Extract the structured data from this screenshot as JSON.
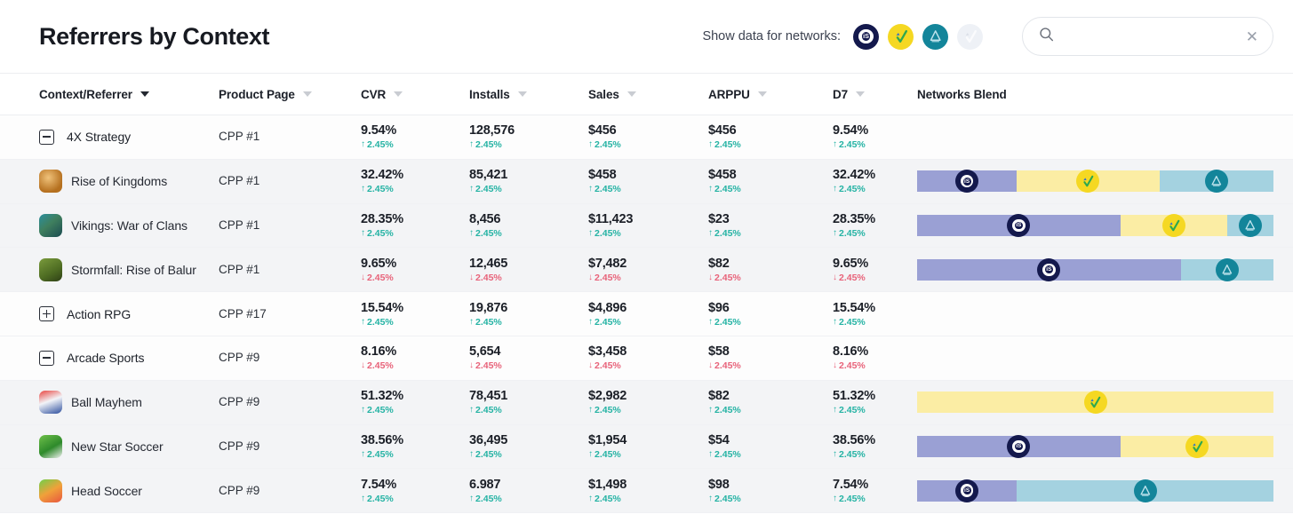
{
  "header": {
    "title": "Referrers by Context",
    "networks_label": "Show data for networks:",
    "networks": [
      {
        "name": "ironSource",
        "icon": "ironsource-icon",
        "active": true
      },
      {
        "name": "Vungle",
        "icon": "vungle-icon",
        "active": true
      },
      {
        "name": "AppLovin",
        "icon": "applovin-icon",
        "active": true
      },
      {
        "name": "Unity Ads",
        "icon": "unity-ads-icon",
        "active": false
      }
    ],
    "search": {
      "value": "",
      "placeholder": "",
      "icon": "search-icon",
      "clear_icon": "close-icon"
    }
  },
  "table": {
    "columns": [
      {
        "key": "context",
        "label": "Context/Referrer",
        "sortable": true,
        "sort_active": true
      },
      {
        "key": "product",
        "label": "Product Page",
        "sortable": true,
        "sort_active": false
      },
      {
        "key": "cvr",
        "label": "CVR",
        "sortable": true,
        "sort_active": false
      },
      {
        "key": "installs",
        "label": "Installs",
        "sortable": true,
        "sort_active": false
      },
      {
        "key": "sales",
        "label": "Sales",
        "sortable": true,
        "sort_active": false
      },
      {
        "key": "arppu",
        "label": "ARPPU",
        "sortable": true,
        "sort_active": false
      },
      {
        "key": "d7",
        "label": "D7",
        "sortable": true,
        "sort_active": false
      },
      {
        "key": "blend",
        "label": "Networks Blend",
        "sortable": false,
        "sort_active": false
      }
    ],
    "rows": [
      {
        "type": "group",
        "expanded": true,
        "name": "4X Strategy",
        "product_page": "CPP #1",
        "cvr": "9.54%",
        "installs": "128,576",
        "sales": "$456",
        "arppu": "$456",
        "d7": "9.54%",
        "delta": "2.45%",
        "trend": "up",
        "blend": []
      },
      {
        "type": "child",
        "icon": "game-icon-rise-of-kingdoms",
        "name": "Rise of Kingdoms",
        "product_page": "CPP #1",
        "cvr": "32.42%",
        "installs": "85,421",
        "sales": "$458",
        "arppu": "$458",
        "d7": "32.42%",
        "delta": "2.45%",
        "trend": "up",
        "blend": [
          {
            "network": "ironSource",
            "pct": 28
          },
          {
            "network": "Vungle",
            "pct": 40
          },
          {
            "network": "AppLovin",
            "pct": 32
          }
        ]
      },
      {
        "type": "child",
        "icon": "game-icon-vikings-war-of-clans",
        "name": "Vikings: War of Clans",
        "product_page": "CPP #1",
        "cvr": "28.35%",
        "installs": "8,456",
        "sales": "$11,423",
        "arppu": "$23",
        "d7": "28.35%",
        "delta": "2.45%",
        "trend": "up",
        "blend": [
          {
            "network": "ironSource",
            "pct": 57
          },
          {
            "network": "Vungle",
            "pct": 30
          },
          {
            "network": "AppLovin",
            "pct": 13
          }
        ]
      },
      {
        "type": "child",
        "icon": "game-icon-stormfall",
        "name": "Stormfall: Rise of Balur",
        "product_page": "CPP #1",
        "cvr": "9.65%",
        "installs": "12,465",
        "sales": "$7,482",
        "arppu": "$82",
        "d7": "9.65%",
        "delta": "2.45%",
        "trend": "down",
        "blend": [
          {
            "network": "ironSource",
            "pct": 74
          },
          {
            "network": "AppLovin",
            "pct": 26
          }
        ]
      },
      {
        "type": "group",
        "expanded": false,
        "name": "Action RPG",
        "product_page": "CPP #17",
        "cvr": "15.54%",
        "installs": "19,876",
        "sales": "$4,896",
        "arppu": "$96",
        "d7": "15.54%",
        "delta": "2.45%",
        "trend": "up",
        "blend": []
      },
      {
        "type": "group",
        "expanded": true,
        "name": "Arcade Sports",
        "product_page": "CPP #9",
        "cvr": "8.16%",
        "installs": "5,654",
        "sales": "$3,458",
        "arppu": "$58",
        "d7": "8.16%",
        "delta": "2.45%",
        "trend": "down",
        "blend": []
      },
      {
        "type": "child",
        "icon": "game-icon-ball-mayhem",
        "name": "Ball Mayhem",
        "product_page": "CPP #9",
        "cvr": "51.32%",
        "installs": "78,451",
        "sales": "$2,982",
        "arppu": "$82",
        "d7": "51.32%",
        "delta": "2.45%",
        "trend": "up",
        "blend": [
          {
            "network": "Vungle",
            "pct": 100
          }
        ]
      },
      {
        "type": "child",
        "icon": "game-icon-new-star-soccer",
        "name": "New Star Soccer",
        "product_page": "CPP #9",
        "cvr": "38.56%",
        "installs": "36,495",
        "sales": "$1,954",
        "arppu": "$54",
        "d7": "38.56%",
        "delta": "2.45%",
        "trend": "up",
        "blend": [
          {
            "network": "ironSource",
            "pct": 57
          },
          {
            "network": "Vungle",
            "pct": 43
          }
        ]
      },
      {
        "type": "child",
        "icon": "game-icon-head-soccer",
        "name": "Head Soccer",
        "product_page": "CPP #9",
        "cvr": "7.54%",
        "installs": "6.987",
        "sales": "$1,498",
        "arppu": "$98",
        "d7": "7.54%",
        "delta": "2.45%",
        "trend": "up",
        "blend": [
          {
            "network": "ironSource",
            "pct": 28
          },
          {
            "network": "AppLovin",
            "pct": 72
          }
        ]
      }
    ]
  },
  "colors": {
    "ironsource": "#14194d",
    "ironsource_bar": "#9aa0d4",
    "vungle": "#f5d822",
    "vungle_bar": "#fbeda4",
    "applovin": "#13859a",
    "applovin_bar": "#a4d2e0",
    "up": "#25b3a4",
    "down": "#e8637a"
  }
}
